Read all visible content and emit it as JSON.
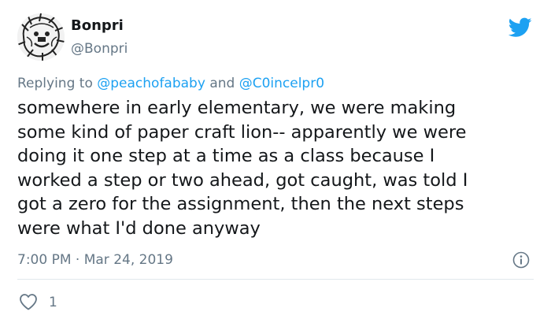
{
  "author": {
    "display_name": "Bonpri",
    "handle": "@Bonpri",
    "avatar_icon": "lion-drawing-avatar"
  },
  "brand": {
    "icon": "twitter-bird-icon",
    "color": "#1da1f2"
  },
  "reply": {
    "prefix": "Replying to",
    "mention_1": "@peachofababy",
    "conjunction": "and",
    "mention_2": "@C0incelpr0"
  },
  "tweet": {
    "lines": [
      "somewhere in early elementary, we were making",
      "some kind of paper craft lion-- apparently we were",
      "doing it one step at a time as a class because I",
      "worked a step or two ahead, got caught, was told I",
      "got a zero for the assignment, then the next steps",
      "were what I'd done anyway"
    ]
  },
  "meta": {
    "time": "7:00 PM",
    "separator": "·",
    "date": "Mar 24, 2019",
    "info_icon": "info-icon"
  },
  "engagement": {
    "like_icon": "heart-icon",
    "like_count": "1"
  },
  "colors": {
    "text": "#14171a",
    "secondary": "#657786",
    "link": "#1da1f2",
    "divider": "#e1e8ed"
  }
}
